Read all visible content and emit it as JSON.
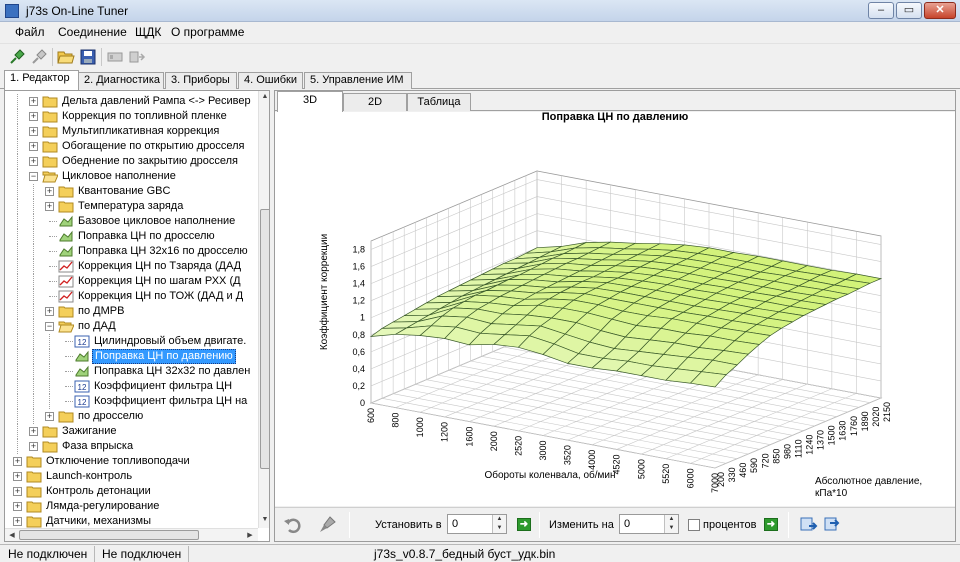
{
  "window": {
    "title": "j73s On-Line Tuner",
    "minimize": "–",
    "maximize": "▭",
    "close": "✕"
  },
  "menu": [
    "Файл",
    "Соединение",
    "ЩДК",
    "О программе"
  ],
  "tabs": [
    "1. Редактор",
    "2. Диагностика",
    "3. Приборы",
    "4. Ошибки",
    "5. Управление ИМ"
  ],
  "tree": {
    "items": [
      {
        "label": "Дельта давлений Рампа <-> Ресивер",
        "level": 2,
        "icon": "folder",
        "expander": "+"
      },
      {
        "label": "Коррекция по топливной пленке",
        "level": 2,
        "icon": "folder",
        "expander": "+"
      },
      {
        "label": "Мультипликативная коррекция",
        "level": 2,
        "icon": "folder",
        "expander": "+"
      },
      {
        "label": "Обогащение по открытию дросселя",
        "level": 2,
        "icon": "folder",
        "expander": "+"
      },
      {
        "label": "Обеднение по закрытию дросселя",
        "level": 2,
        "icon": "folder",
        "expander": "+"
      },
      {
        "label": "Цикловое наполнение",
        "level": 2,
        "icon": "folder-open",
        "expander": "-"
      },
      {
        "label": "Квантование GBC",
        "level": 3,
        "icon": "folder",
        "expander": "+"
      },
      {
        "label": "Температура заряда",
        "level": 3,
        "icon": "folder",
        "expander": "+"
      },
      {
        "label": "Базовое цикловое наполнение",
        "level": 3,
        "icon": "map3d",
        "expander": ""
      },
      {
        "label": "Поправка ЦН по дросселю",
        "level": 3,
        "icon": "map3d",
        "expander": ""
      },
      {
        "label": "Поправка ЦН 32x16 по дросселю",
        "level": 3,
        "icon": "map3d",
        "expander": ""
      },
      {
        "label": "Коррекция ЦН по Тзаряда  (ДАД",
        "level": 3,
        "icon": "graph",
        "expander": ""
      },
      {
        "label": "Коррекция ЦН по шагам РХХ  (Д",
        "level": 3,
        "icon": "graph",
        "expander": ""
      },
      {
        "label": "Коррекция ЦН по ТОЖ  (ДАД и Д",
        "level": 3,
        "icon": "graph",
        "expander": ""
      },
      {
        "label": "по ДМРВ",
        "level": 3,
        "icon": "folder",
        "expander": "+"
      },
      {
        "label": "по ДАД",
        "level": 3,
        "icon": "folder-open",
        "expander": "-"
      },
      {
        "label": "Цилиндровый объем двигате.",
        "level": 4,
        "icon": "num12",
        "expander": ""
      },
      {
        "label": "Поправка ЦН по давлению",
        "level": 4,
        "icon": "map3d",
        "expander": "",
        "selected": true
      },
      {
        "label": "Поправка ЦН 32x32 по давлен",
        "level": 4,
        "icon": "map3d",
        "expander": ""
      },
      {
        "label": "Коэффициент фильтра ЦН",
        "level": 4,
        "icon": "num12",
        "expander": ""
      },
      {
        "label": "Коэффициент фильтра ЦН на",
        "level": 4,
        "icon": "num12",
        "expander": ""
      },
      {
        "label": "по дросселю",
        "level": 3,
        "icon": "folder",
        "expander": "+"
      },
      {
        "label": "Зажигание",
        "level": 2,
        "icon": "folder",
        "expander": "+"
      },
      {
        "label": "Фаза впрыска",
        "level": 2,
        "icon": "folder",
        "expander": "+"
      },
      {
        "label": "Отключение топливоподачи",
        "level": 1,
        "icon": "folder",
        "expander": "+"
      },
      {
        "label": "Launch-контроль",
        "level": 1,
        "icon": "folder",
        "expander": "+"
      },
      {
        "label": "Контроль детонации",
        "level": 1,
        "icon": "folder",
        "expander": "+"
      },
      {
        "label": "Лямда-регулирование",
        "level": 1,
        "icon": "folder",
        "expander": "+"
      },
      {
        "label": "Датчики, механизмы",
        "level": 1,
        "icon": "folder",
        "expander": "+"
      }
    ]
  },
  "content_tabs": [
    "3D",
    "2D",
    "Таблица"
  ],
  "chart_data": {
    "type": "surface3d",
    "title": "Поправка ЦН по давлению",
    "xlabel": "Обороты коленвала, об/мин",
    "ylabel": "Абсолютное давление, кПа*10",
    "zlabel": "Коэффициент коррекции",
    "x_ticks": [
      "600",
      "800",
      "1000",
      "1200",
      "1600",
      "2000",
      "2520",
      "3000",
      "3520",
      "4000",
      "4520",
      "5000",
      "5520",
      "6000",
      "7000"
    ],
    "y_ticks": [
      "200",
      "330",
      "460",
      "590",
      "720",
      "850",
      "980",
      "1110",
      "1240",
      "1370",
      "1500",
      "1630",
      "1760",
      "1890",
      "2020",
      "2150"
    ],
    "z_ticks": [
      "0",
      "0,2",
      "0,4",
      "0,6",
      "0,8",
      "1",
      "1,2",
      "1,4",
      "1,6",
      "1,8"
    ],
    "zlim": [
      0,
      1.9
    ],
    "z_values": [
      [
        0.78,
        0.82,
        0.84,
        0.86,
        0.88,
        0.9,
        0.92,
        0.93,
        0.94,
        0.95,
        0.96,
        0.97,
        0.98,
        0.98,
        0.99,
        1.0
      ],
      [
        0.86,
        0.88,
        0.9,
        0.92,
        0.94,
        0.96,
        0.98,
        0.99,
        1.0,
        1.01,
        1.02,
        1.03,
        1.04,
        1.05,
        1.06,
        1.07
      ],
      [
        0.9,
        0.96,
        1.02,
        1.06,
        1.08,
        1.1,
        1.1,
        1.11,
        1.12,
        1.12,
        1.13,
        1.14,
        1.15,
        1.15,
        1.16,
        1.17
      ],
      [
        0.92,
        1.0,
        1.06,
        1.1,
        1.12,
        1.14,
        1.15,
        1.16,
        1.17,
        1.18,
        1.19,
        1.2,
        1.2,
        1.21,
        1.22,
        1.23
      ],
      [
        0.9,
        0.98,
        1.04,
        1.1,
        1.14,
        1.16,
        1.18,
        1.19,
        1.2,
        1.21,
        1.22,
        1.23,
        1.24,
        1.25,
        1.26,
        1.27
      ],
      [
        0.96,
        1.02,
        1.08,
        1.14,
        1.2,
        1.22,
        1.24,
        1.25,
        1.26,
        1.26,
        1.27,
        1.28,
        1.29,
        1.3,
        1.31,
        1.32
      ],
      [
        0.98,
        1.06,
        1.12,
        1.16,
        1.22,
        1.26,
        1.28,
        1.29,
        1.3,
        1.3,
        1.31,
        1.32,
        1.33,
        1.34,
        1.35,
        1.36
      ],
      [
        0.95,
        1.02,
        1.08,
        1.16,
        1.22,
        1.26,
        1.28,
        1.3,
        1.31,
        1.32,
        1.33,
        1.34,
        1.35,
        1.36,
        1.37,
        1.38
      ],
      [
        0.9,
        0.96,
        1.04,
        1.12,
        1.2,
        1.24,
        1.28,
        1.3,
        1.32,
        1.33,
        1.34,
        1.35,
        1.36,
        1.37,
        1.38,
        1.38
      ],
      [
        0.9,
        0.96,
        1.02,
        1.1,
        1.18,
        1.24,
        1.28,
        1.3,
        1.32,
        1.33,
        1.34,
        1.35,
        1.36,
        1.37,
        1.38,
        1.39
      ],
      [
        0.92,
        0.98,
        1.04,
        1.12,
        1.2,
        1.26,
        1.28,
        1.3,
        1.32,
        1.34,
        1.35,
        1.36,
        1.36,
        1.37,
        1.38,
        1.39
      ],
      [
        0.92,
        0.98,
        1.06,
        1.14,
        1.2,
        1.26,
        1.29,
        1.31,
        1.33,
        1.34,
        1.35,
        1.36,
        1.37,
        1.38,
        1.38,
        1.39
      ],
      [
        0.92,
        1.0,
        1.08,
        1.14,
        1.22,
        1.26,
        1.29,
        1.32,
        1.33,
        1.35,
        1.36,
        1.36,
        1.37,
        1.38,
        1.39,
        1.39
      ],
      [
        0.94,
        1.02,
        1.1,
        1.16,
        1.22,
        1.27,
        1.3,
        1.32,
        1.34,
        1.35,
        1.36,
        1.37,
        1.38,
        1.38,
        1.39,
        1.4
      ],
      [
        0.95,
        1.04,
        1.1,
        1.17,
        1.23,
        1.28,
        1.31,
        1.33,
        1.35,
        1.36,
        1.37,
        1.38,
        1.38,
        1.39,
        1.4,
        1.4
      ]
    ],
    "surface_color": "#d9f2a0",
    "surface_stroke": "#3a5a2a",
    "grid": true
  },
  "bottom": {
    "set_label": "Установить в",
    "set_value": "0",
    "change_label": "Изменить на",
    "change_value": "0",
    "percent_label": "процентов"
  },
  "status": {
    "left1": "Не подключен",
    "left2": "Не подключен",
    "file": "j73s_v0.8.7_бедный буст_удк.bin"
  }
}
